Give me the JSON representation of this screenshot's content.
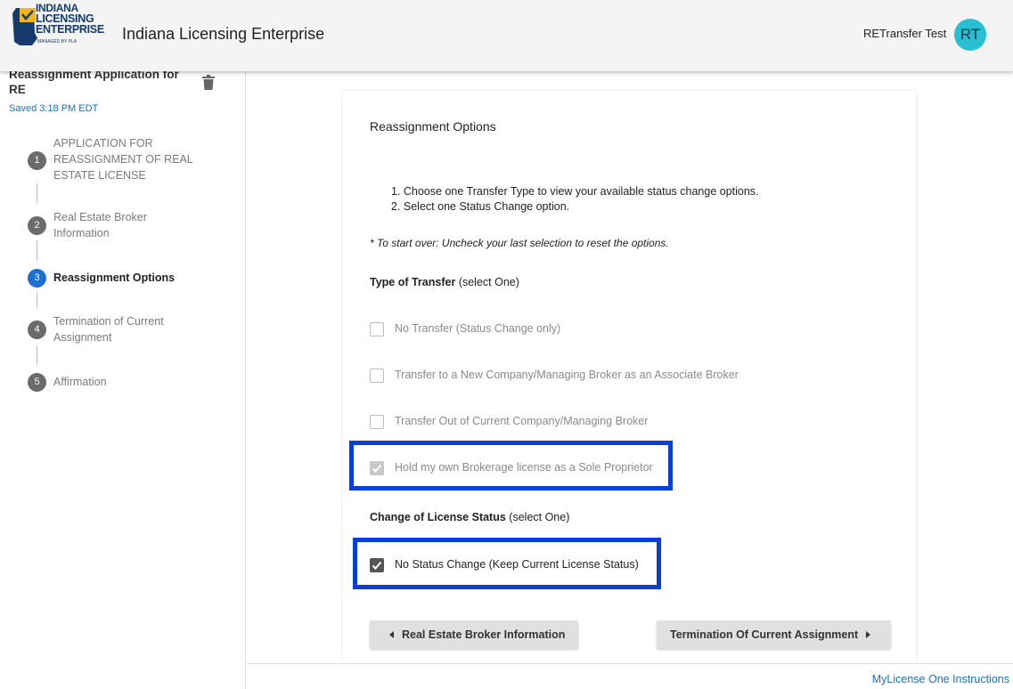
{
  "header": {
    "logo_lines": [
      "INDIANA",
      "LICENSING",
      "ENTERPRISE"
    ],
    "logo_managed": "MANAGED BY PLA",
    "title": "Indiana Licensing Enterprise",
    "user_name": "RETransfer Test",
    "avatar_initials": "RT",
    "avatar_color": "#29bfd3"
  },
  "sidebar": {
    "app_name": "Reassignment Application for RE",
    "saved": "Saved 3:18 PM EDT",
    "steps": [
      {
        "num": "1",
        "label": "APPLICATION FOR REASSIGNMENT OF REAL ESTATE LICENSE",
        "active": false
      },
      {
        "num": "2",
        "label": "Real Estate Broker Information",
        "active": false
      },
      {
        "num": "3",
        "label": "Reassignment Options",
        "active": true
      },
      {
        "num": "4",
        "label": "Termination of Current Assignment",
        "active": false
      },
      {
        "num": "5",
        "label": "Affirmation",
        "active": false
      }
    ]
  },
  "main": {
    "title": "Reassignment Options",
    "instructions": [
      "1. Choose one Transfer Type to view your available status change options.",
      "2. Select one Status Change option."
    ],
    "note": "* To start over: Uncheck your last selection to reset the options.",
    "transfer_heading": "Type of Transfer",
    "transfer_hint": "(select One)",
    "transfer_options": [
      {
        "label": "No Transfer (Status Change only)",
        "checked": false
      },
      {
        "label": "Transfer to a New Company/Managing Broker as an Associate Broker",
        "checked": false
      },
      {
        "label": "Transfer Out of Current Company/Managing Broker",
        "checked": false
      },
      {
        "label": "Hold my own Brokerage license as a Sole Proprietor",
        "checked": true
      }
    ],
    "status_heading": "Change of License Status",
    "status_hint": "(select One)",
    "status_options": [
      {
        "label": "No Status Change (Keep Current License Status)",
        "checked": true
      }
    ],
    "back_button": "Real Estate Broker Information",
    "next_button": "Termination Of Current Assignment"
  },
  "footer": {
    "link": "MyLicense One Instructions"
  },
  "colors": {
    "accent_blue": "#1f6fd0",
    "highlight_blue": "#0a3fd6",
    "link_blue": "#1f6fb3"
  }
}
